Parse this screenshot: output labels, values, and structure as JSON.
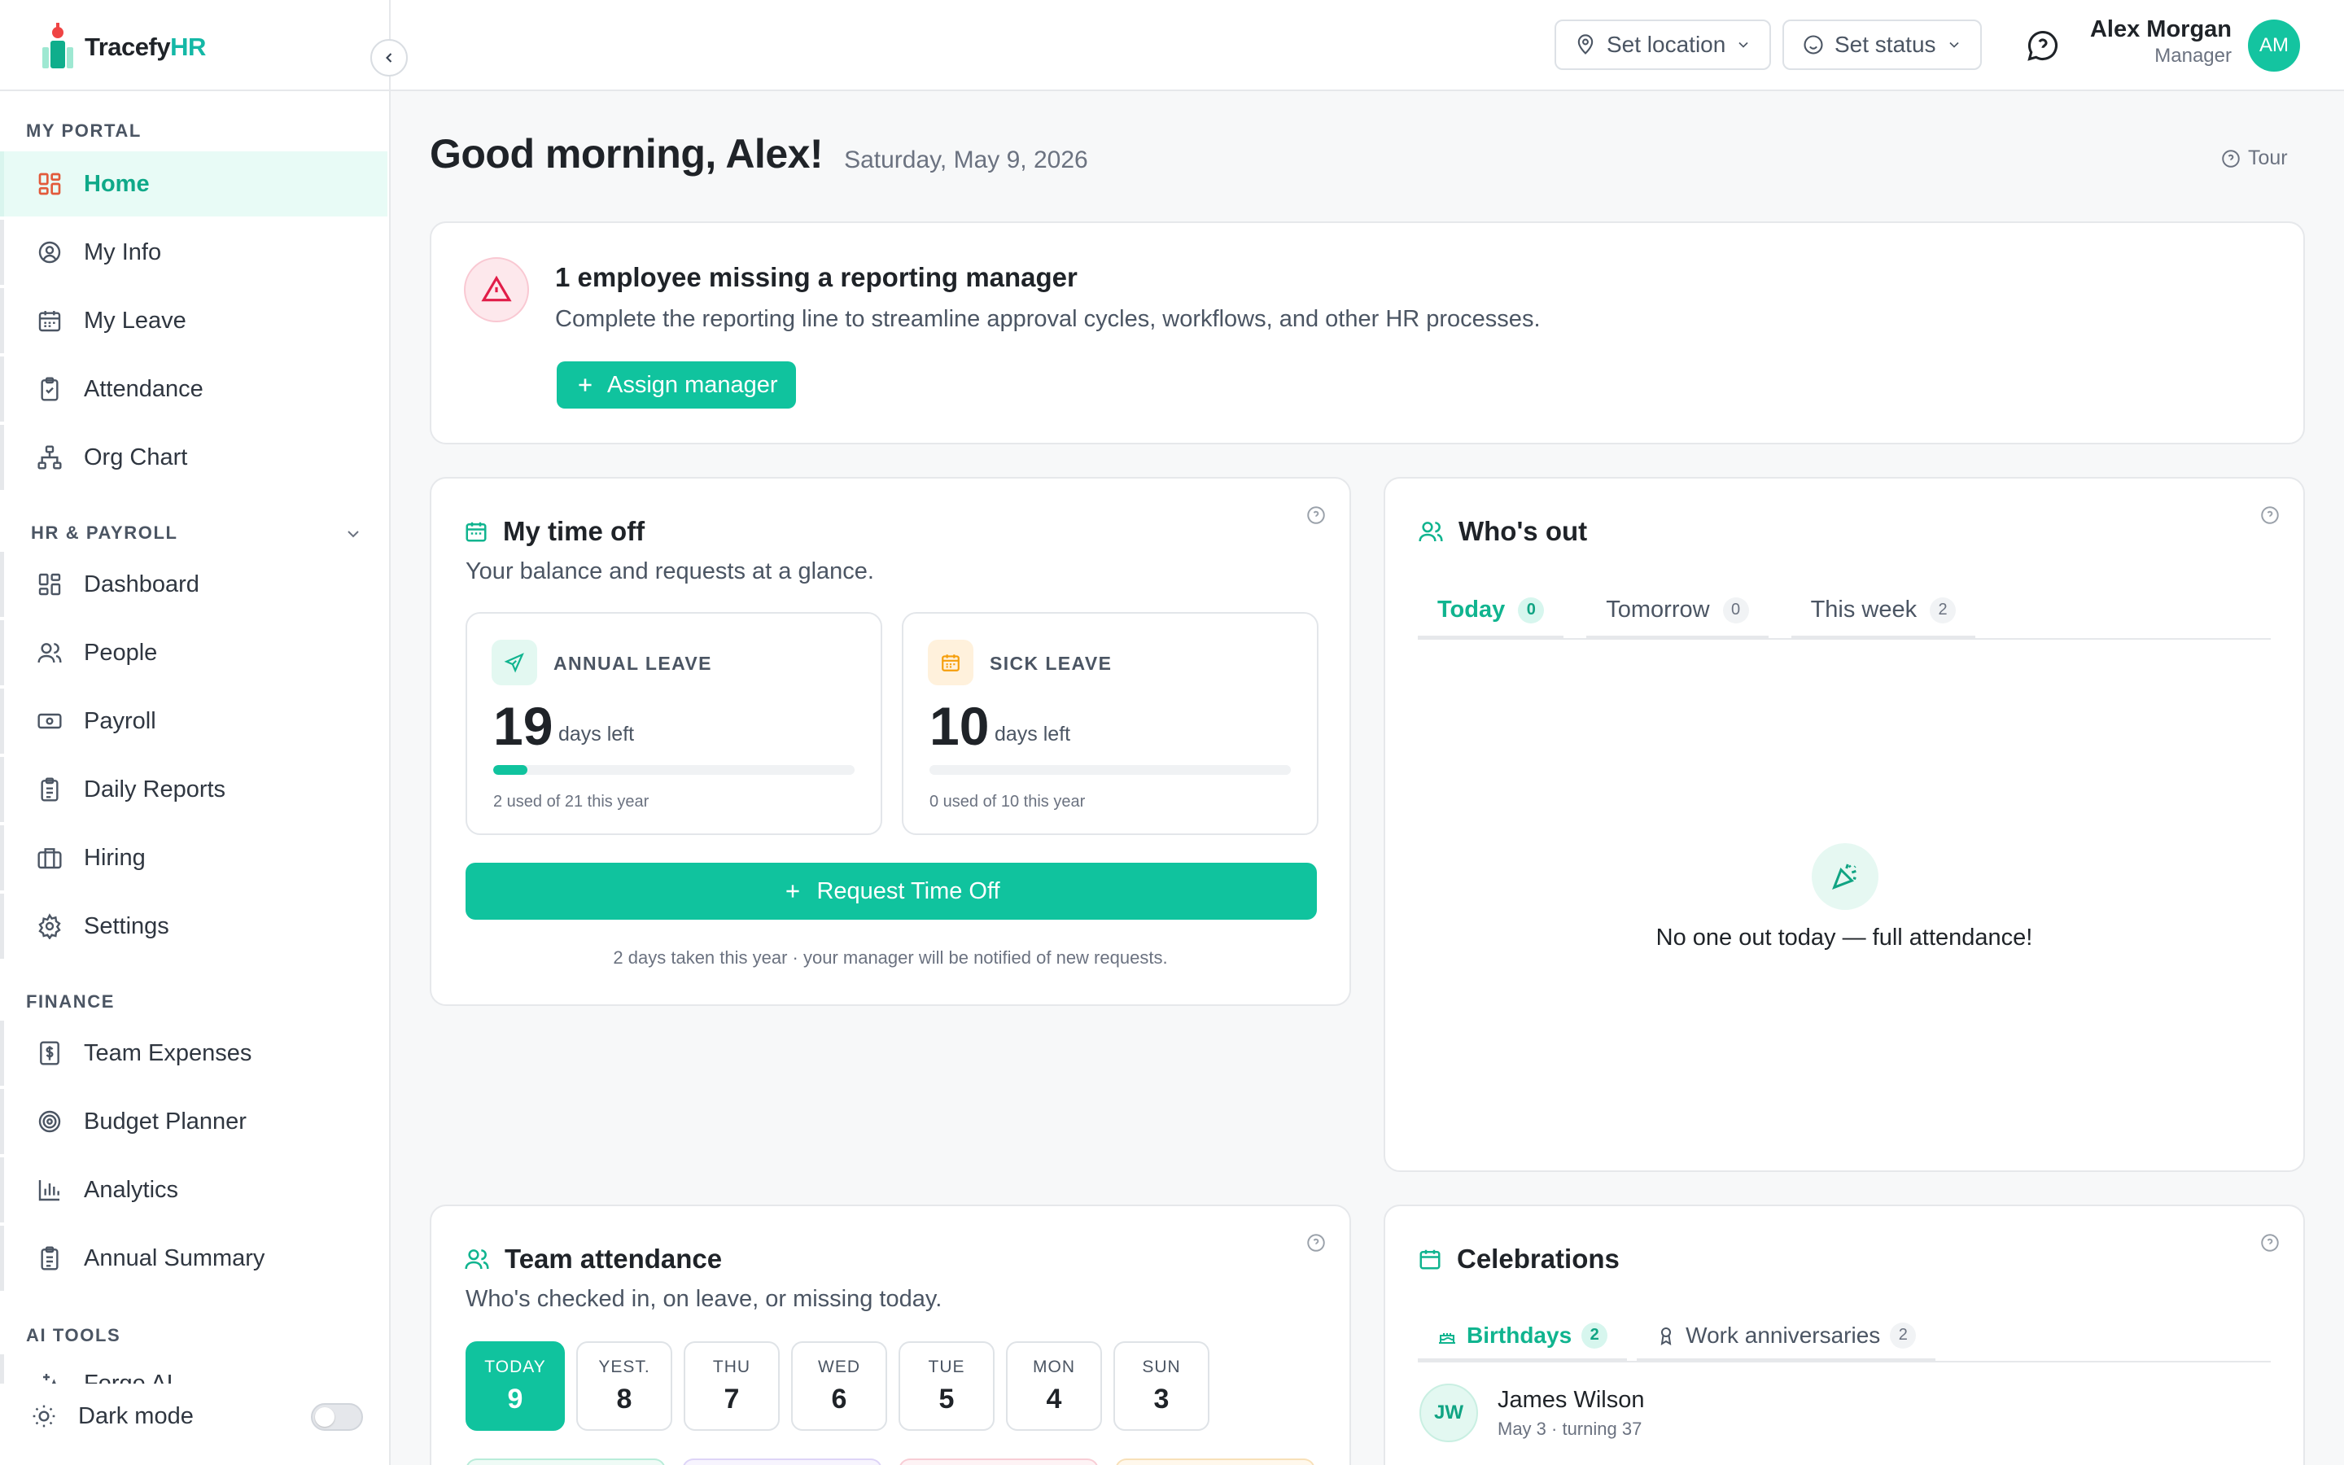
{
  "brand": {
    "name_prefix": "Tracefy",
    "name_suffix": "HR"
  },
  "sidebar": {
    "sections": {
      "my_portal": "MY PORTAL",
      "hr_payroll": "HR & PAYROLL",
      "finance": "FINANCE",
      "ai_tools": "AI TOOLS"
    },
    "my_portal_items": [
      {
        "label": "Home",
        "icon": "grid-icon",
        "active": true
      },
      {
        "label": "My Info",
        "icon": "user-circle-icon"
      },
      {
        "label": "My Leave",
        "icon": "calendar-icon"
      },
      {
        "label": "Attendance",
        "icon": "clipboard-check-icon"
      },
      {
        "label": "Org Chart",
        "icon": "org-chart-icon"
      }
    ],
    "hr_items": [
      {
        "label": "Dashboard",
        "icon": "grid-icon"
      },
      {
        "label": "People",
        "icon": "people-icon"
      },
      {
        "label": "Payroll",
        "icon": "money-icon"
      },
      {
        "label": "Daily Reports",
        "icon": "clipboard-icon"
      },
      {
        "label": "Hiring",
        "icon": "briefcase-icon"
      },
      {
        "label": "Settings",
        "icon": "gear-icon"
      }
    ],
    "finance_items": [
      {
        "label": "Team Expenses",
        "icon": "receipt-icon"
      },
      {
        "label": "Budget Planner",
        "icon": "target-icon"
      },
      {
        "label": "Analytics",
        "icon": "bar-chart-icon"
      },
      {
        "label": "Annual Summary",
        "icon": "clipboard-icon"
      }
    ],
    "ai_items": [
      {
        "label": "Forge AI",
        "icon": "sparkle-icon"
      }
    ],
    "dark_mode_label": "Dark mode"
  },
  "header": {
    "location_label": "Set location",
    "status_label": "Set status",
    "user_name": "Alex Morgan",
    "user_role": "Manager",
    "avatar_initials": "AM"
  },
  "main": {
    "greeting": "Good morning, Alex!",
    "date": "Saturday, May 9, 2026",
    "tour_label": "Tour",
    "alert": {
      "title": "1 employee missing a reporting manager",
      "description": "Complete the reporting line to streamline approval cycles, workflows, and other HR processes.",
      "button": "Assign manager"
    },
    "time_off": {
      "title": "My time off",
      "subtitle": "Your balance and requests at a glance.",
      "annual": {
        "name": "ANNUAL LEAVE",
        "days": "19",
        "days_label": "days left",
        "used": "2 used of 21 this year",
        "progress": 0.095
      },
      "sick": {
        "name": "SICK LEAVE",
        "days": "10",
        "days_label": "days left",
        "used": "0 used of 10 this year",
        "progress": 0
      },
      "request_button": "Request Time Off",
      "note": "2 days taken this year · your manager will be notified of new requests."
    },
    "whos_out": {
      "title": "Who's out",
      "tabs": [
        {
          "label": "Today",
          "count": "0"
        },
        {
          "label": "Tomorrow",
          "count": "0"
        },
        {
          "label": "This week",
          "count": "2"
        }
      ],
      "empty_text": "No one out today — full attendance!"
    },
    "team_attendance": {
      "title": "Team attendance",
      "subtitle": "Who's checked in, on leave, or missing today.",
      "days": [
        {
          "name": "TODAY",
          "num": "9"
        },
        {
          "name": "YEST.",
          "num": "8"
        },
        {
          "name": "THU",
          "num": "7"
        },
        {
          "name": "WED",
          "num": "6"
        },
        {
          "name": "TUE",
          "num": "5"
        },
        {
          "name": "MON",
          "num": "4"
        },
        {
          "name": "SUN",
          "num": "3"
        }
      ]
    },
    "celebrations": {
      "title": "Celebrations",
      "tabs": [
        {
          "label": "Birthdays",
          "count": "2"
        },
        {
          "label": "Work anniversaries",
          "count": "2"
        }
      ],
      "people": [
        {
          "initials": "JW",
          "name": "James Wilson",
          "meta": "May 3 · turning 37"
        }
      ]
    }
  },
  "colors": {
    "accent": "#10c39e",
    "alert": "#e11d48",
    "sick": "#f59e0b"
  }
}
